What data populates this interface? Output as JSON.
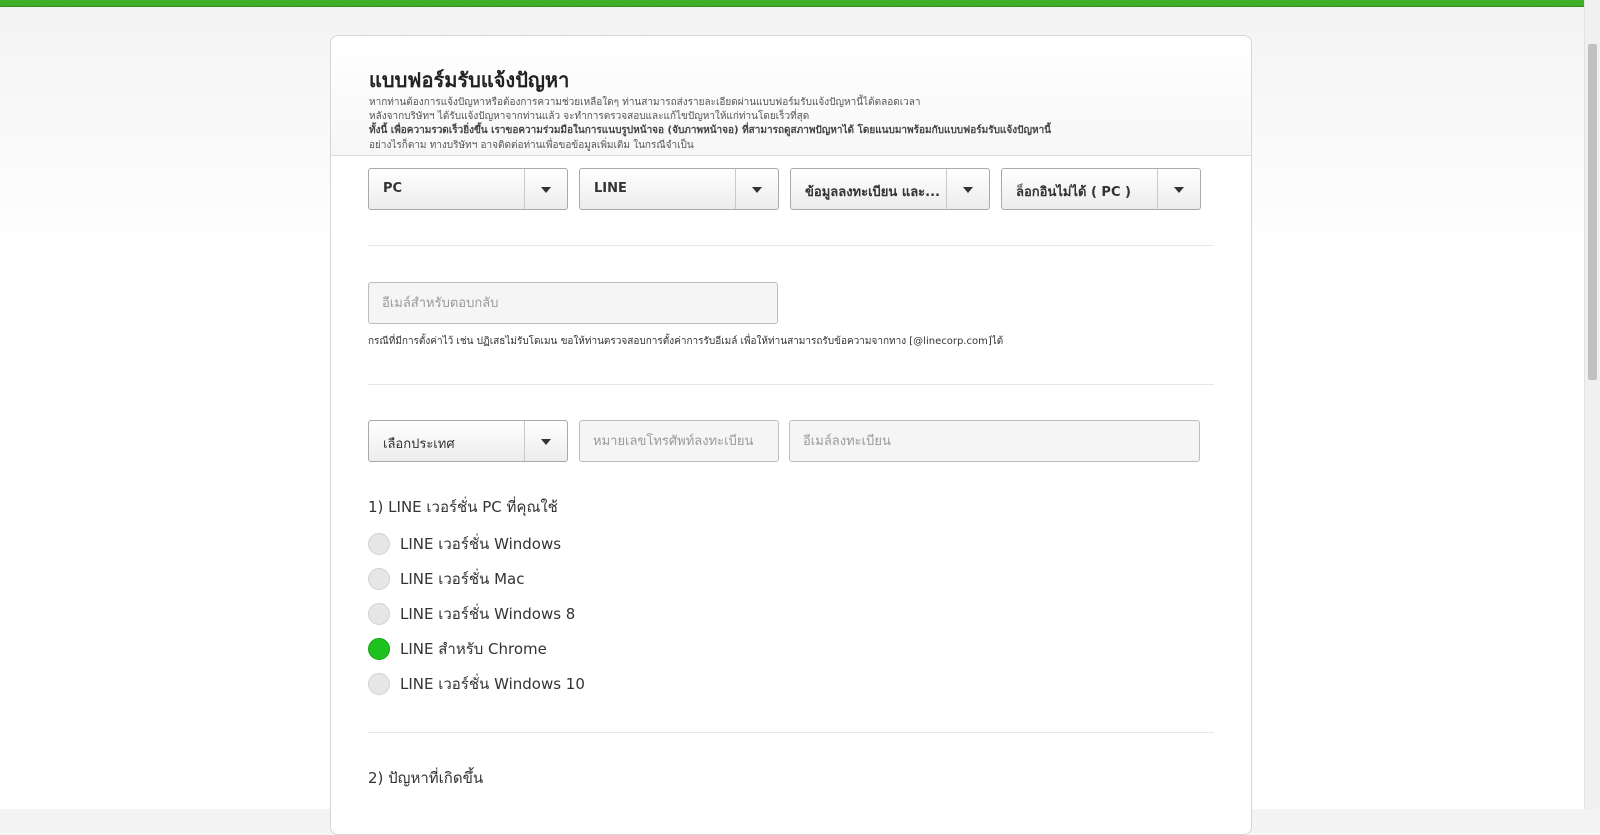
{
  "form": {
    "title": "แบบฟอร์มรับแจ้งปัญหา",
    "desc_line1": "หากท่านต้องการแจ้งปัญหาหรือต้องการความช่วยเหลือใดๆ ท่านสามารถส่งรายละเอียดผ่านแบบฟอร์มรับแจ้งปัญหานี้ได้ตลอดเวลา",
    "desc_line2": "หลังจากบริษัทฯ ได้รับแจ้งปัญหาจากท่านแล้ว จะทำการตรวจสอบและแก้ไขปัญหาให้แก่ท่านโดยเร็วที่สุด",
    "desc_line3": "ทั้งนี้ เพื่อความรวดเร็วยิ่งขึ้น เราขอความร่วมมือในการแนบรูปหน้าจอ (จับภาพหน้าจอ) ที่สามารถดูสภาพปัญหาได้ โดยแนบมาพร้อมกับแบบฟอร์มรับแจ้งปัญหานี้",
    "desc_line4": "อย่างไรก็ตาม ทางบริษัทฯ อาจติดต่อท่านเพื่อขอข้อมูลเพิ่มเติม ในกรณีจำเป็น"
  },
  "selects": {
    "device": "PC",
    "service": "LINE",
    "category": "ข้อมูลลงทะเบียน และ...",
    "issue": "ล็อกอินไม่ได้ ( PC )"
  },
  "email": {
    "placeholder": "อีเมล์สำหรับตอบกลับ",
    "hint": "กรณีที่มีการตั้งค่าไว้ เช่น ปฏิเสธไม่รับโดเมน ขอให้ท่านตรวจสอบการตั้งค่าการรับอีเมล์ เพื่อให้ท่านสามารถรับข้อความจากทาง [@linecorp.com]ได้"
  },
  "registration": {
    "country": "เลือกประเทศ",
    "phone_placeholder": "หมายเลขโทรศัพท์ลงทะเบียน",
    "email_placeholder": "อีเมล์ลงทะเบียน"
  },
  "question1": {
    "title": "1) LINE เวอร์ชั่น PC ที่คุณใช้",
    "options": [
      {
        "label": "LINE เวอร์ชั่น Windows",
        "checked": false
      },
      {
        "label": "LINE เวอร์ชั่น Mac",
        "checked": false
      },
      {
        "label": "LINE เวอร์ชั่น Windows 8",
        "checked": false
      },
      {
        "label": "LINE สำหรับ Chrome",
        "checked": true
      },
      {
        "label": "LINE เวอร์ชั่น Windows 10",
        "checked": false
      }
    ]
  },
  "question2": {
    "title": "2) ปัญหาที่เกิดขึ้น"
  },
  "colors": {
    "accent": "#3fae29",
    "radio_checked": "#1fc11f"
  }
}
